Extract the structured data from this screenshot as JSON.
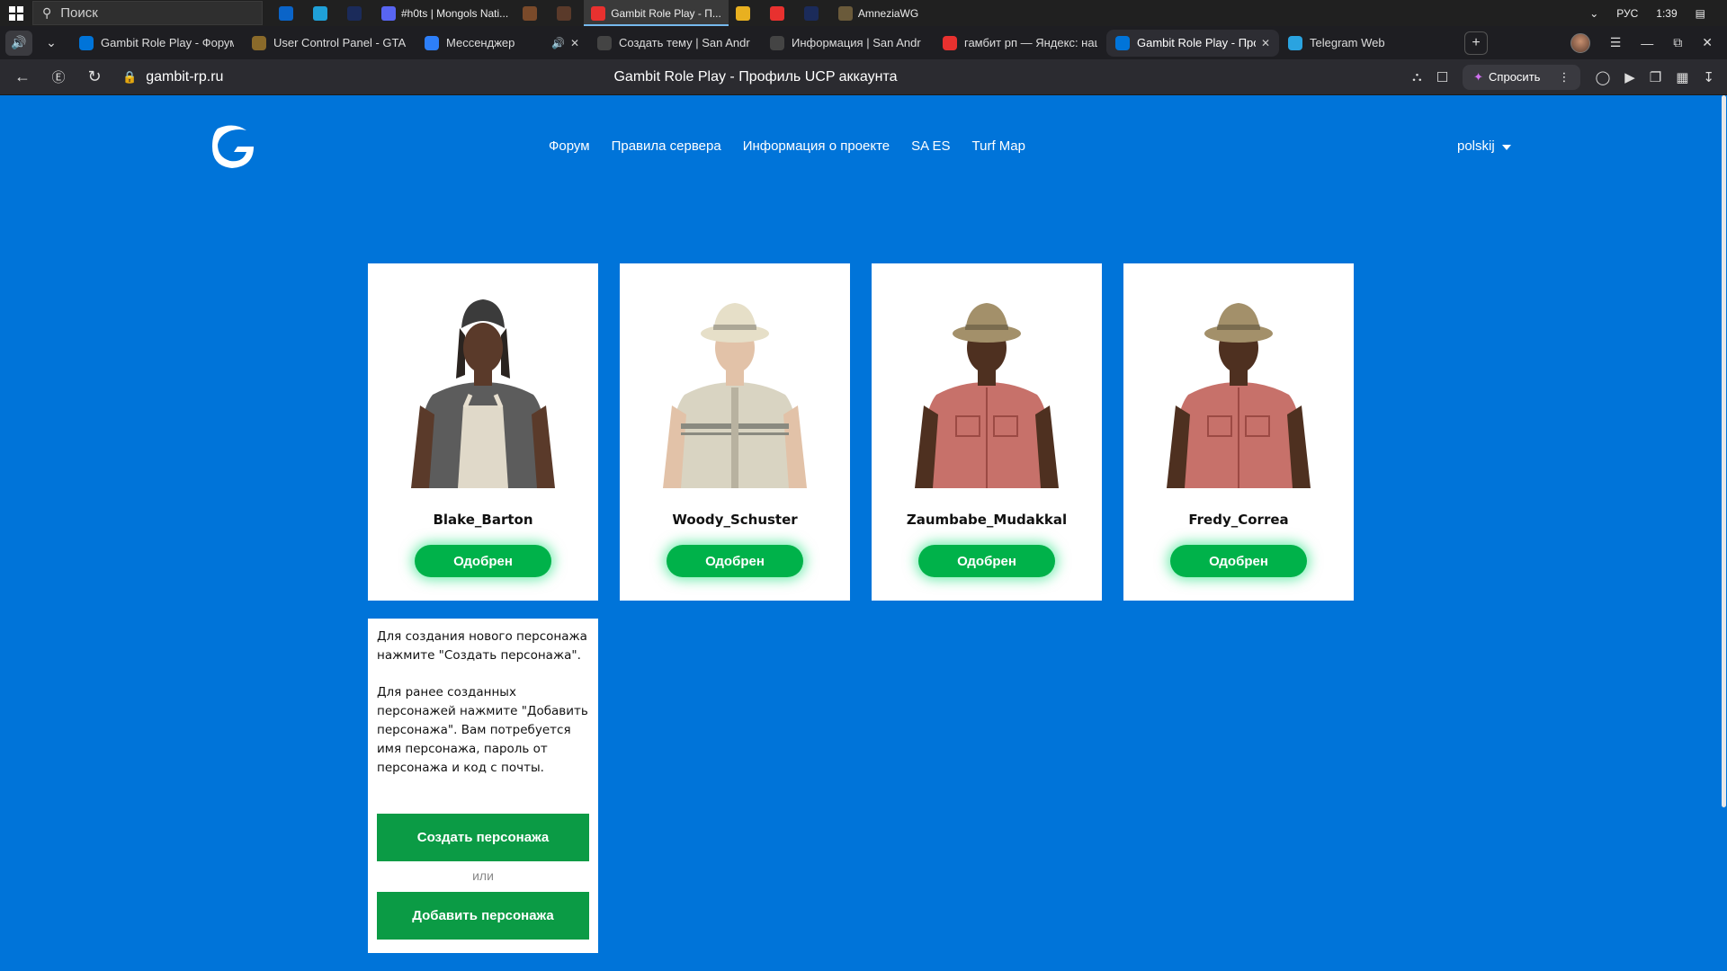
{
  "taskbar": {
    "search_placeholder": "Поиск",
    "apps": [
      {
        "label": "",
        "icon": "outlook-icon",
        "color": "#0a64c8"
      },
      {
        "label": "",
        "icon": "edge-icon",
        "color": "#1fa0d8"
      },
      {
        "label": "",
        "icon": "photoshop-icon",
        "color": "#1b2b5a"
      },
      {
        "label": "#h0ts | Mongols Nati...",
        "icon": "discord-icon",
        "color": "#5865f2"
      },
      {
        "label": "",
        "icon": "game-icon",
        "color": "#7a4a2a"
      },
      {
        "label": "",
        "icon": "game2-icon",
        "color": "#5a3a2a"
      },
      {
        "label": "Gambit Role Play - П...",
        "icon": "yandex-browser-icon",
        "color": "#e8312f",
        "active": true
      },
      {
        "label": "",
        "icon": "folder-icon",
        "color": "#e8b020"
      },
      {
        "label": "",
        "icon": "yandex-icon",
        "color": "#e8312f"
      },
      {
        "label": "",
        "icon": "photoshop-icon",
        "color": "#1b2b5a"
      },
      {
        "label": "AmneziaWG",
        "icon": "amnezia-icon",
        "color": "#6a5a3a"
      }
    ],
    "lang": "РУС",
    "time": "1:39"
  },
  "tabs": [
    {
      "title": "Gambit Role Play - Форум",
      "fav_color": "#0074d9"
    },
    {
      "title": "User Control Panel - GTA",
      "fav_color": "#8a6a2a"
    },
    {
      "title": "Мессенджер",
      "fav_color": "#2d7ff9",
      "audio": true,
      "closable": true
    },
    {
      "title": "Создать тему | San Andr",
      "fav_color": "#444"
    },
    {
      "title": "Информация | San Andr",
      "fav_color": "#444"
    },
    {
      "title": "гамбит рп — Яндекс: нашл",
      "fav_color": "#e8312f"
    },
    {
      "title": "Gambit Role Play - Проф",
      "fav_color": "#0074d9",
      "active": true,
      "closable": true
    },
    {
      "title": "Telegram Web",
      "fav_color": "#2aa3e0"
    }
  ],
  "addressbar": {
    "url": "gambit-rp.ru",
    "page_title": "Gambit Role Play - Профиль UCP аккаунта",
    "ask_label": "Спросить"
  },
  "site": {
    "nav": [
      "Форум",
      "Правила сервера",
      "Информация о проекте",
      "SA ES",
      "Turf Map"
    ],
    "language": "polskij"
  },
  "characters": [
    {
      "name": "Blake_Barton",
      "status": "Одобрен",
      "skin": {
        "hat": "#3b3b3b",
        "shirt": "#5c5c5c",
        "apron": "#e7dfcf",
        "skin": "#5a3a2a"
      }
    },
    {
      "name": "Woody_Schuster",
      "status": "Одобрен",
      "skin": {
        "hat": "#e6dfc8",
        "shirt": "#d9d4c2",
        "apron": "",
        "skin": "#e2c2a8"
      }
    },
    {
      "name": "Zaumbabe_Mudakkal",
      "status": "Одобрен",
      "skin": {
        "hat": "#a3906a",
        "shirt": "#c7716a",
        "apron": "",
        "skin": "#4e3020"
      }
    },
    {
      "name": "Fredy_Correa",
      "status": "Одобрен",
      "skin": {
        "hat": "#a3906a",
        "shirt": "#c7716a",
        "apron": "",
        "skin": "#4e3020"
      }
    }
  ],
  "info": {
    "text1": "Для создания нового персонажа нажмите \"Создать персонажа\".",
    "text2": "Для ранее созданных персонажей нажмите \"Добавить персонажа\". Вам потребуется имя персонажа, пароль от персонажа и код с почты.",
    "create_label": "Создать персонажа",
    "or_label": "или",
    "add_label": "Добавить персонажа"
  },
  "colors": {
    "page_bg": "#0074d9",
    "approved": "#00b24a",
    "action_green": "#0b9b45"
  }
}
